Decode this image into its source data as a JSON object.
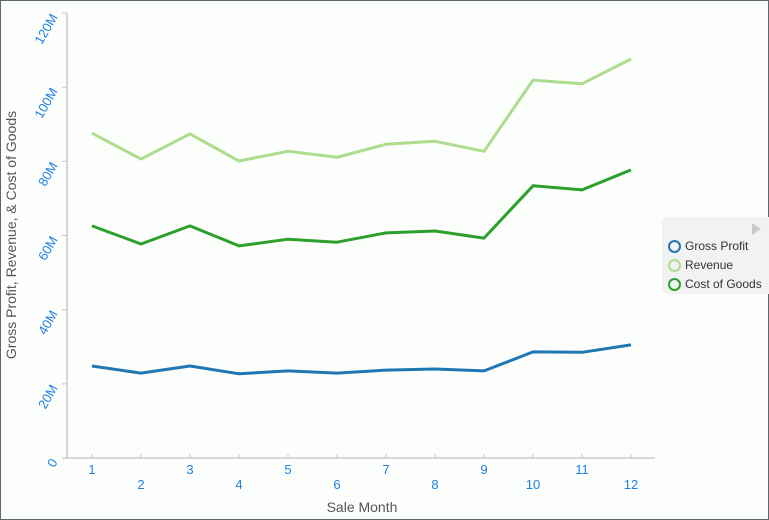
{
  "chart_data": {
    "type": "line",
    "title": "",
    "xlabel": "Sale Month",
    "ylabel": "Gross Profit, Revenue, & Cost of Goods",
    "x": [
      1,
      2,
      3,
      4,
      5,
      6,
      7,
      8,
      9,
      10,
      11,
      12
    ],
    "x_tick_labels": [
      "1",
      "2",
      "3",
      "4",
      "5",
      "6",
      "7",
      "8",
      "9",
      "10",
      "11",
      "12"
    ],
    "ylim": [
      0,
      120000000
    ],
    "y_ticks": [
      0,
      20000000,
      40000000,
      60000000,
      80000000,
      100000000,
      120000000
    ],
    "y_tick_labels": [
      "0",
      "20M",
      "40M",
      "60M",
      "80M",
      "100M",
      "120M"
    ],
    "grid": false,
    "legend_position": "right",
    "series": [
      {
        "name": "Gross Profit",
        "color": "#1f77b4",
        "values": [
          24800000,
          22900000,
          24800000,
          22700000,
          23500000,
          22900000,
          23700000,
          24000000,
          23500000,
          28600000,
          28500000,
          30500000
        ]
      },
      {
        "name": "Revenue",
        "color": "#aedc8e",
        "values": [
          87600000,
          80600000,
          87400000,
          80100000,
          82700000,
          81100000,
          84600000,
          85400000,
          82700000,
          101900000,
          100900000,
          107600000
        ]
      },
      {
        "name": "Cost of Goods",
        "color": "#2ca02c",
        "values": [
          62600000,
          57700000,
          62600000,
          57200000,
          59000000,
          58200000,
          60700000,
          61200000,
          59300000,
          73400000,
          72300000,
          77700000
        ]
      }
    ]
  },
  "legend": {
    "items": [
      {
        "label": "Gross Profit",
        "color": "#1f77b4"
      },
      {
        "label": "Revenue",
        "color": "#aedc8e"
      },
      {
        "label": "Cost of Goods",
        "color": "#2ca02c"
      }
    ],
    "scroll_icon": "play-right-icon"
  },
  "colors": {
    "tick_label": "#1f7fe0",
    "axis": "#c8c8c8",
    "axis_title": "#555555"
  }
}
